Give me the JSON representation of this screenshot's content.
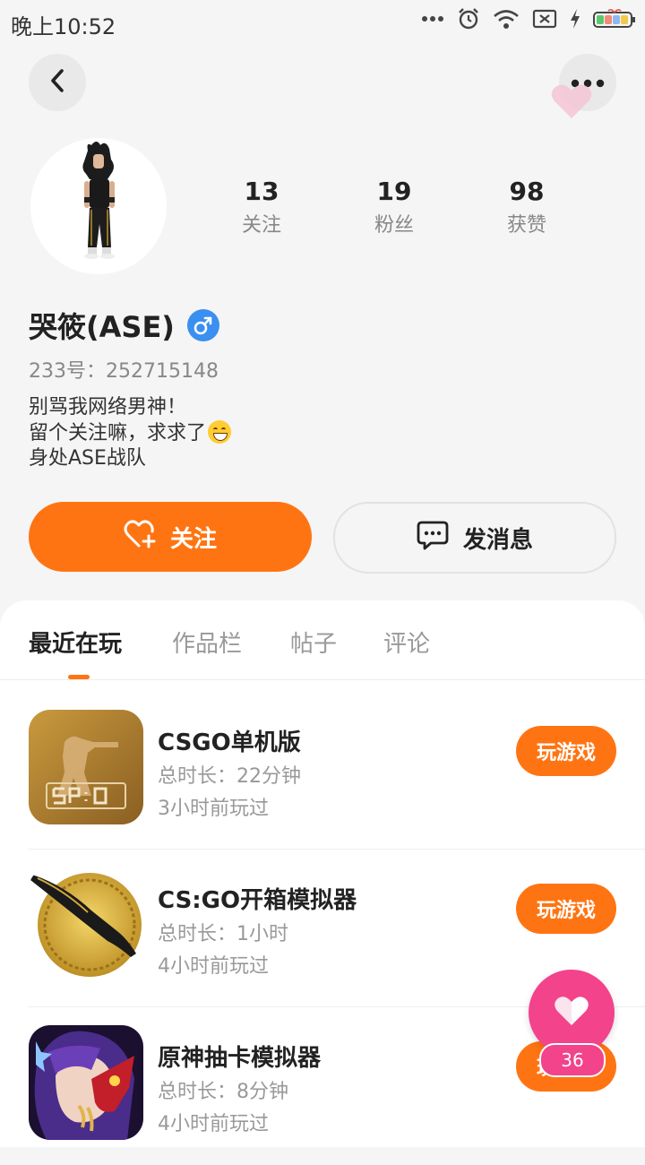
{
  "status_bar": {
    "time": "晚上10:52",
    "icons": [
      "more-dots-icon",
      "alarm-icon",
      "wifi-icon",
      "sim-x-icon",
      "charging-icon",
      "battery-icon"
    ]
  },
  "nav": {
    "back_icon": "chevron-left-icon",
    "more_icon": "more-horizontal-icon"
  },
  "profile": {
    "stats": [
      {
        "value": "13",
        "label": "关注"
      },
      {
        "value": "19",
        "label": "粉丝"
      },
      {
        "value": "98",
        "label": "获赞"
      }
    ],
    "username": "哭筱(ASE)",
    "gender": "male",
    "user_id": "233号：252715148",
    "bio": [
      "别骂我网络男神！",
      "留个关注嘛，求求了",
      "身处ASE战队"
    ]
  },
  "actions": {
    "follow_label": "关注",
    "message_label": "发消息"
  },
  "tabs": [
    "最近在玩",
    "作品栏",
    "帖子",
    "评论"
  ],
  "active_tab": "最近在玩",
  "games": [
    {
      "name": "CSGO单机版",
      "duration": "总时长：22分钟",
      "last_played": "3小时前玩过",
      "button": "玩游戏"
    },
    {
      "name": "CS:GO开箱模拟器",
      "duration": "总时长：1小时",
      "last_played": "4小时前玩过",
      "button": "玩游戏"
    },
    {
      "name": "原神抽卡模拟器",
      "duration": "总时长：8分钟",
      "last_played": "4小时前玩过",
      "button": "玩游戏"
    }
  ],
  "floating_like": {
    "count": "36"
  },
  "colors": {
    "accent": "#ff7412",
    "like_pink": "#f2438b",
    "gender_blue": "#3a8ff0",
    "background": "#f5f5f5"
  }
}
